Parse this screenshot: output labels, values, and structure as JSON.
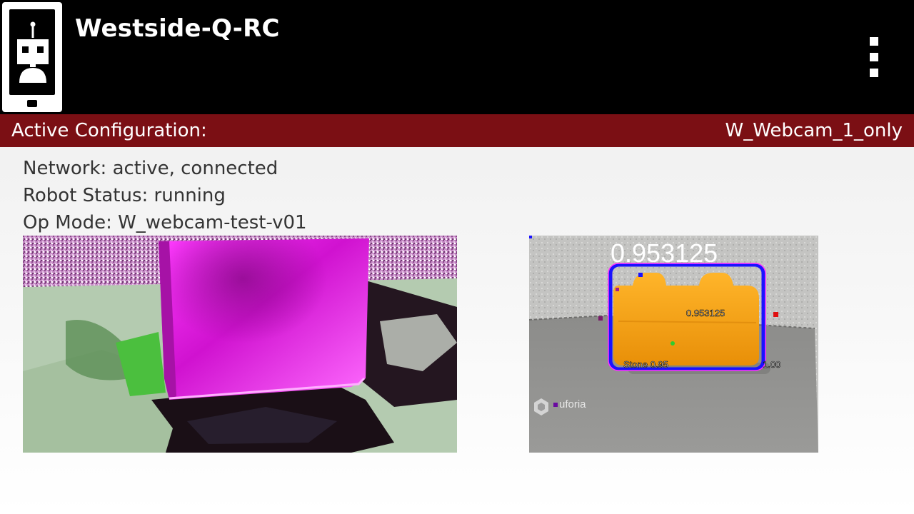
{
  "app": {
    "title": "Westside-Q-RC"
  },
  "config": {
    "label": "Active Configuration:",
    "value": "W_Webcam_1_only"
  },
  "status": {
    "network": "Network: active, connected",
    "robot": "Robot Status: running",
    "opmode": "Op Mode: W_webcam-test-v01"
  },
  "detection": {
    "confidence_top": "0.953125",
    "confidence_mid": "0.953125",
    "label": "Stone 0.95",
    "right_value": "1.00",
    "watermark": "uforia"
  },
  "colors": {
    "appbar": "#000000",
    "config_bar": "#7b0f14",
    "box_stroke": "#1a12ff",
    "stone": "#f6a10b"
  }
}
